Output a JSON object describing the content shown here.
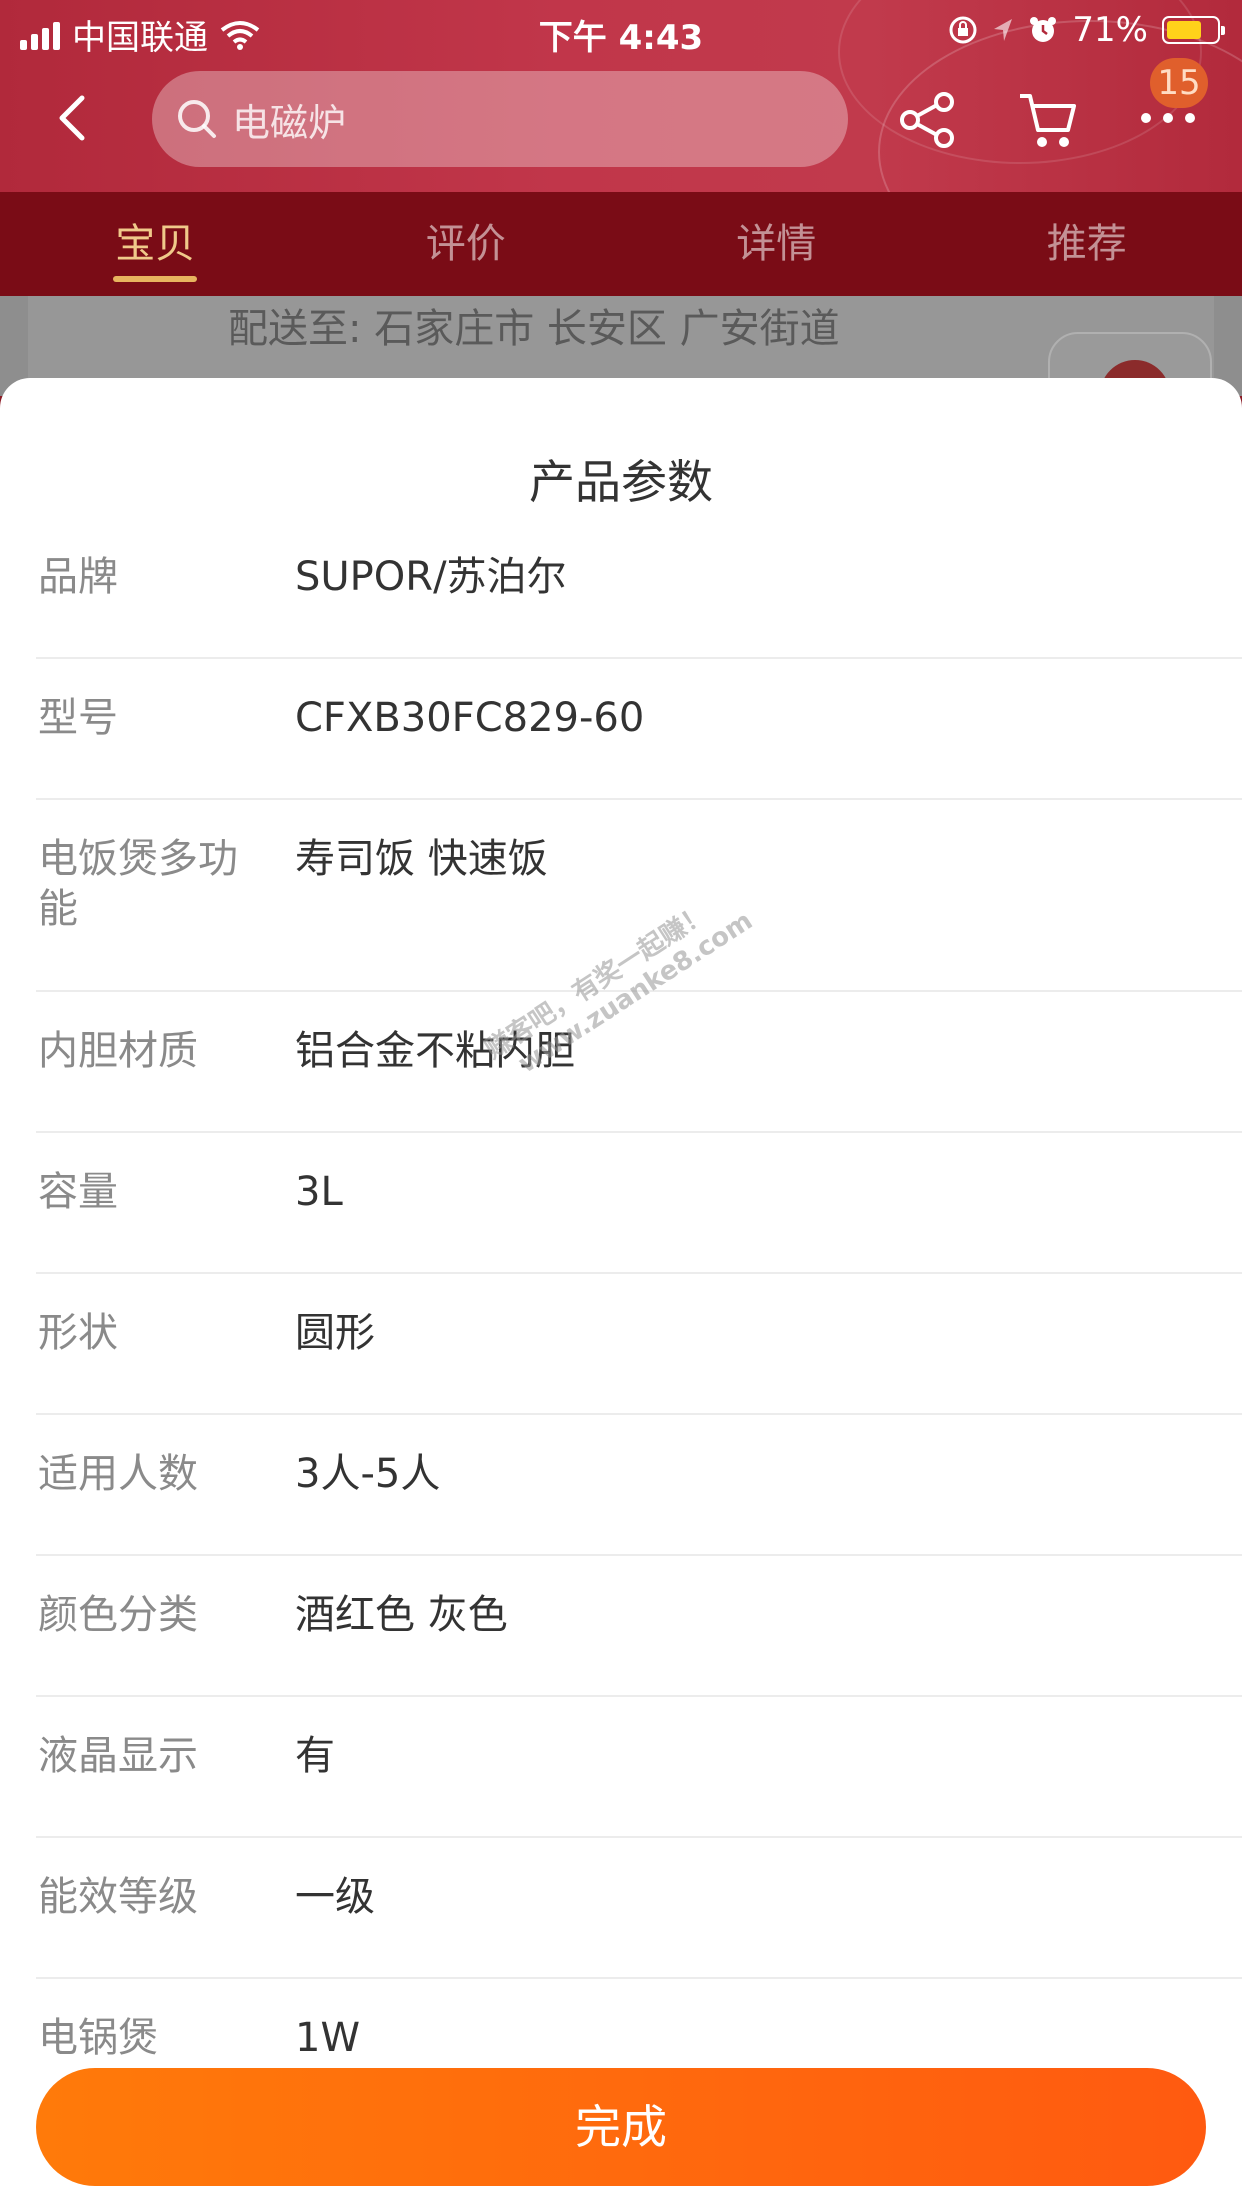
{
  "status_bar": {
    "carrier": "中国联通",
    "time": "下午 4:43",
    "battery_text": "71%",
    "battery_percent": 71
  },
  "header": {
    "search_text": "电磁炉",
    "cart_count": "15"
  },
  "tabs": [
    {
      "label": "宝贝",
      "active": true
    },
    {
      "label": "评价",
      "active": false
    },
    {
      "label": "详情",
      "active": false
    },
    {
      "label": "推荐",
      "active": false
    }
  ],
  "background_page": {
    "delivery_text": "配送至: 石家庄市 长安区 广安街道"
  },
  "sheet": {
    "title": "产品参数",
    "params": [
      {
        "key": "品牌",
        "value": "SUPOR/苏泊尔"
      },
      {
        "key": "型号",
        "value": "CFXB30FC829-60"
      },
      {
        "key": "电饭煲多功能",
        "value": "寿司饭 快速饭"
      },
      {
        "key": "内胆材质",
        "value": "铝合金不粘内胆"
      },
      {
        "key": "容量",
        "value": "3L"
      },
      {
        "key": "形状",
        "value": "圆形"
      },
      {
        "key": "适用人数",
        "value": "3人-5人"
      },
      {
        "key": "颜色分类",
        "value": "酒红色 灰色"
      },
      {
        "key": "液晶显示",
        "value": "有"
      },
      {
        "key": "能效等级",
        "value": "一级"
      },
      {
        "key": "电锅煲",
        "value": "1W"
      }
    ],
    "done_label": "完成"
  },
  "watermark": {
    "line1": "赚客吧，有奖一起赚！",
    "line2": "www.zuanke8.com"
  },
  "colors": {
    "accent": "#ff6a0e",
    "header_red": "#c1364a",
    "tab_bar": "#7a0c16",
    "active_tab": "#f0c98a"
  }
}
